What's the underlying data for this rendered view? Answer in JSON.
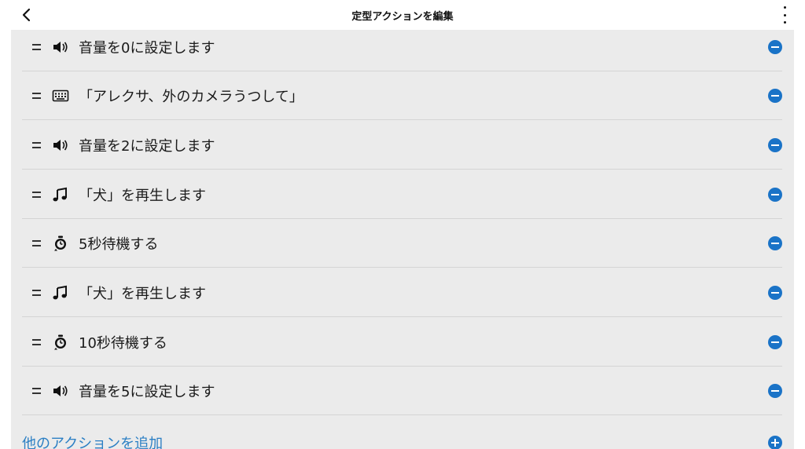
{
  "header": {
    "title": "定型アクションを編集"
  },
  "actions": [
    {
      "icon": "speaker-icon",
      "label": "音量を0に設定します"
    },
    {
      "icon": "keyboard-icon",
      "label": "「アレクサ、外のカメラうつして」"
    },
    {
      "icon": "speaker-icon",
      "label": "音量を2に設定します"
    },
    {
      "icon": "music-note-icon",
      "label": "「犬」を再生します"
    },
    {
      "icon": "timer-icon",
      "label": "5秒待機する"
    },
    {
      "icon": "music-note-icon",
      "label": "「犬」を再生します"
    },
    {
      "icon": "timer-icon",
      "label": "10秒待機する"
    },
    {
      "icon": "speaker-icon",
      "label": "音量を5に設定します"
    }
  ],
  "add_action": {
    "label": "他のアクションを追加"
  },
  "colors": {
    "accent": "#1a73c7",
    "link": "#2b7fc4",
    "panel_bg": "#ebebeb"
  }
}
